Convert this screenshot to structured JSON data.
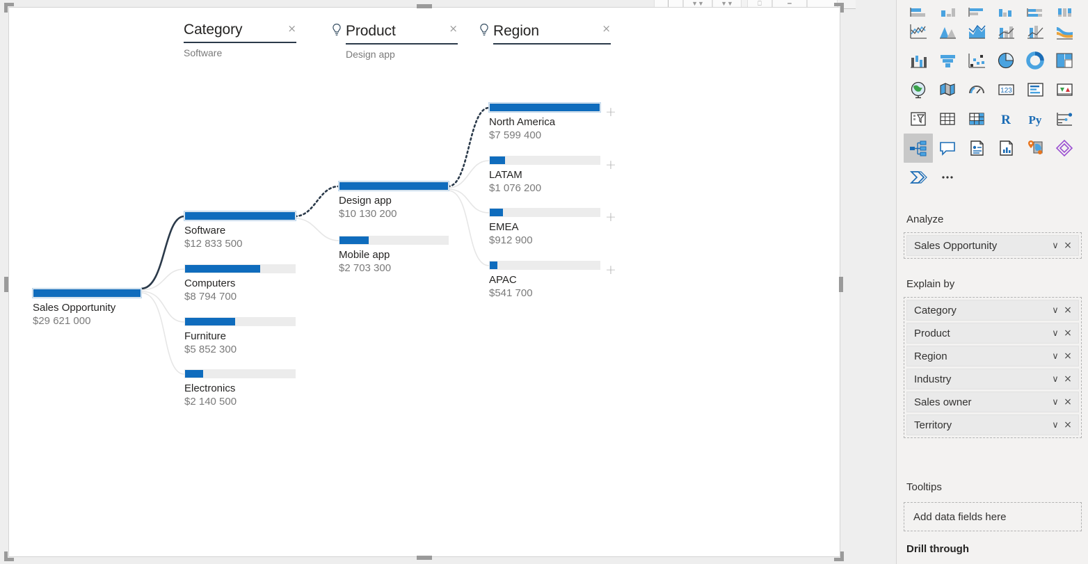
{
  "visual": {
    "type": "decomposition-tree",
    "accent_color": "#0f6cbd",
    "track_color": "#ececec",
    "selected_link_color": "#2b3a4a"
  },
  "levels": [
    {
      "title": "Category",
      "selected_value": "Software",
      "has_ai_bulb": false,
      "close_label": "×"
    },
    {
      "title": "Product",
      "selected_value": "Design app",
      "has_ai_bulb": true,
      "close_label": "×"
    },
    {
      "title": "Region",
      "selected_value": "",
      "has_ai_bulb": true,
      "close_label": "×"
    }
  ],
  "root": {
    "label": "Sales Opportunity",
    "value": "$29 621 000"
  },
  "chart_data": {
    "type": "bar",
    "title": "Sales Opportunity decomposition tree",
    "measure": "Sales Opportunity",
    "total": 29621000,
    "levels": [
      "Root",
      "Category",
      "Product",
      "Region"
    ],
    "nodes": [
      {
        "level": "Root",
        "label": "Sales Opportunity",
        "value": 29621000,
        "value_text": "$29 621 000",
        "bar_ratio": 1.0,
        "selected": true,
        "parent": null
      },
      {
        "level": "Category",
        "label": "Software",
        "value": 12833500,
        "value_text": "$12 833 500",
        "bar_ratio": 1.0,
        "selected": true,
        "parent": "Sales Opportunity"
      },
      {
        "level": "Category",
        "label": "Computers",
        "value": 8794700,
        "value_text": "$8 794 700",
        "bar_ratio": 0.685,
        "selected": false,
        "parent": "Sales Opportunity"
      },
      {
        "level": "Category",
        "label": "Furniture",
        "value": 5852300,
        "value_text": "$5 852 300",
        "bar_ratio": 0.456,
        "selected": false,
        "parent": "Sales Opportunity"
      },
      {
        "level": "Category",
        "label": "Electronics",
        "value": 2140500,
        "value_text": "$2 140 500",
        "bar_ratio": 0.167,
        "selected": false,
        "parent": "Sales Opportunity"
      },
      {
        "level": "Product",
        "label": "Design app",
        "value": 10130200,
        "value_text": "$10 130 200",
        "bar_ratio": 1.0,
        "selected": true,
        "parent": "Software"
      },
      {
        "level": "Product",
        "label": "Mobile app",
        "value": 2703300,
        "value_text": "$2 703 300",
        "bar_ratio": 0.267,
        "selected": false,
        "parent": "Software"
      },
      {
        "level": "Region",
        "label": "North America",
        "value": 7599400,
        "value_text": "$7 599 400",
        "bar_ratio": 1.0,
        "selected": true,
        "parent": "Design app",
        "expandable": true
      },
      {
        "level": "Region",
        "label": "LATAM",
        "value": 1076200,
        "value_text": "$1 076 200",
        "bar_ratio": 0.142,
        "selected": false,
        "parent": "Design app",
        "expandable": true
      },
      {
        "level": "Region",
        "label": "EMEA",
        "value": 912900,
        "value_text": "$912 900",
        "bar_ratio": 0.12,
        "selected": false,
        "parent": "Design app",
        "expandable": true
      },
      {
        "level": "Region",
        "label": "APAC",
        "value": 541700,
        "value_text": "$541 700",
        "bar_ratio": 0.071,
        "selected": false,
        "parent": "Design app",
        "expandable": true
      }
    ]
  },
  "nodes": {
    "root": {
      "label": "Sales Opportunity",
      "value": "$29 621 000"
    },
    "software": {
      "label": "Software",
      "value": "$12 833 500"
    },
    "computers": {
      "label": "Computers",
      "value": "$8 794 700"
    },
    "furniture": {
      "label": "Furniture",
      "value": "$5 852 300"
    },
    "electronics": {
      "label": "Electronics",
      "value": "$2 140 500"
    },
    "designapp": {
      "label": "Design app",
      "value": "$10 130 200"
    },
    "mobileapp": {
      "label": "Mobile app",
      "value": "$2 703 300"
    },
    "northamerica": {
      "label": "North America",
      "value": "$7 599 400"
    },
    "latam": {
      "label": "LATAM",
      "value": "$1 076 200"
    },
    "emea": {
      "label": "EMEA",
      "value": "$912 900"
    },
    "apac": {
      "label": "APAC",
      "value": "$541 700"
    }
  },
  "expand_button_label": "+",
  "panel": {
    "gallery": {
      "rows": [
        [
          "stacked-bar-chart-icon",
          "stacked-column-chart-icon",
          "clustered-bar-chart-icon",
          "clustered-column-chart-icon",
          "hundred-percent-stacked-bar-chart-icon",
          "hundred-percent-stacked-column-chart-icon"
        ],
        [
          "line-chart-icon",
          "area-chart-icon",
          "stacked-area-chart-icon",
          "line-and-stacked-column-chart-icon",
          "line-and-clustered-column-chart-icon",
          "ribbon-chart-icon"
        ],
        [
          "waterfall-chart-icon",
          "funnel-chart-icon",
          "scatter-chart-icon",
          "pie-chart-icon",
          "donut-chart-icon",
          "treemap-icon"
        ],
        [
          "map-icon",
          "filled-map-icon",
          "gauge-icon",
          "card-icon",
          "multi-row-card-icon",
          "kpi-icon"
        ],
        [
          "slicer-icon",
          "table-icon",
          "matrix-icon",
          "r-script-visual-icon",
          "python-visual-icon",
          "key-influencers-icon"
        ],
        [
          "decomposition-tree-icon",
          "q-and-a-icon",
          "smart-narrative-icon",
          "paginated-report-icon",
          "azure-map-icon",
          "power-apps-icon"
        ],
        [
          "power-automate-icon",
          "more-options-icon"
        ]
      ],
      "selected": "decomposition-tree-icon"
    },
    "analyze": {
      "title": "Analyze",
      "fields": [
        {
          "label": "Sales Opportunity",
          "chevron": "∨",
          "remove": "×"
        }
      ]
    },
    "explain_by": {
      "title": "Explain by",
      "fields": [
        {
          "label": "Category",
          "chevron": "∨",
          "remove": "×"
        },
        {
          "label": "Product",
          "chevron": "∨",
          "remove": "×"
        },
        {
          "label": "Region",
          "chevron": "∨",
          "remove": "×"
        },
        {
          "label": "Industry",
          "chevron": "∨",
          "remove": "×"
        },
        {
          "label": "Sales owner",
          "chevron": "∨",
          "remove": "×"
        },
        {
          "label": "Territory",
          "chevron": "∨",
          "remove": "×"
        }
      ]
    },
    "tooltips": {
      "title": "Tooltips",
      "placeholder": "Add data fields here"
    },
    "drill_through": {
      "title": "Drill through"
    }
  }
}
